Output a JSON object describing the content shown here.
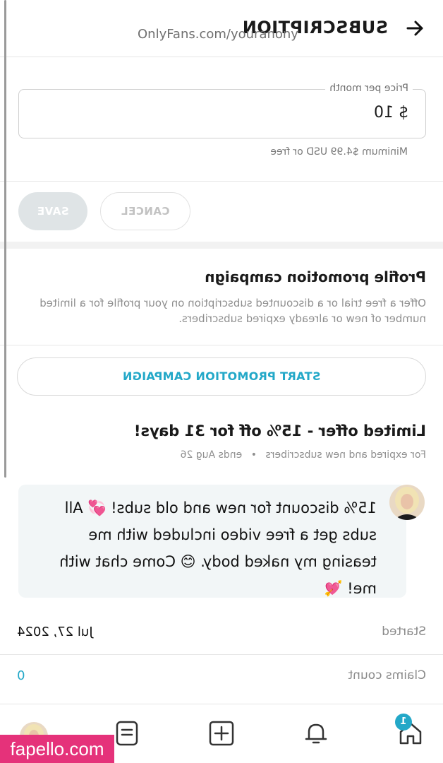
{
  "header": {
    "title": "SUBSCRIPTION",
    "back_icon": "arrow-left-icon"
  },
  "price": {
    "label": "Price per month",
    "value": "$ 10",
    "hint": "Minimum $4.99 USD or free"
  },
  "actions": {
    "cancel_label": "CANCEL",
    "save_label": "SAVE"
  },
  "promotion": {
    "title": "Profile promotion campaign",
    "description": "Offer a free trial or a discounted subscription on your profile for a limited number of new or already expired subscribers.",
    "start_label": "START PROMOTION CAMPAIGN"
  },
  "offer": {
    "title": "Limited offer - 15% off for 31 days!",
    "audience": "For expired and new subscribers",
    "separator": "•",
    "ends": "ends Aug 26",
    "message": "15% discount for new and old subs! 💞 All subs get a free video included with me teasing my naked body. 😊 Come chat with me! 💘",
    "started_label": "Started",
    "started_value": "Jul 27, 2024",
    "claims_label": "Claims count",
    "claims_value": "0"
  },
  "nav": {
    "home_badge": "1",
    "url": "OnlyFans.com/youranony",
    "icons": [
      "home-icon",
      "bell-icon",
      "add-post-icon",
      "messages-icon",
      "avatar"
    ]
  },
  "watermark": "fapello.com",
  "colors": {
    "accent": "#23a8c8",
    "muted": "#8f8f8f",
    "watermark_bg": "#e5327a"
  }
}
